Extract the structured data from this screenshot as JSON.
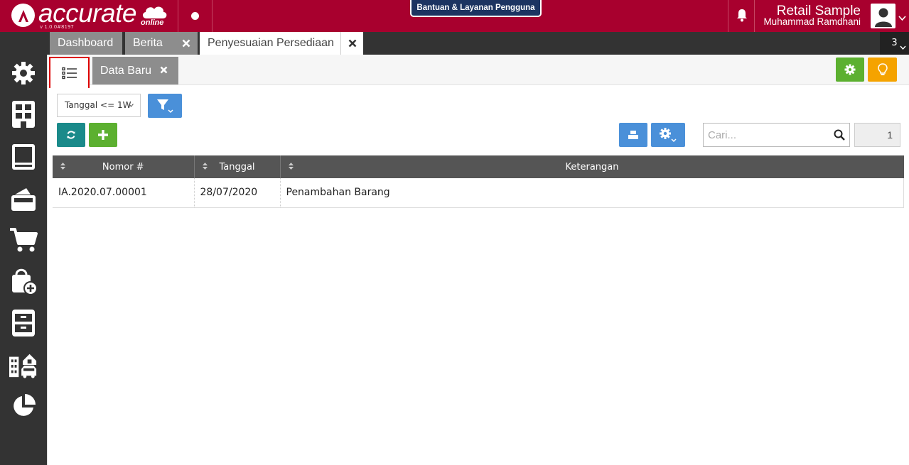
{
  "header": {
    "logo_text": "accurate",
    "logo_sub": "online",
    "version": "v 1.0.0#8197",
    "help_label": "Bantuan & Layanan Pengguna",
    "company": "Retail Sample",
    "user": "Muhammad Ramdhani",
    "brand_color": "#a8002e"
  },
  "tabs": [
    {
      "label": "Dashboard",
      "closable": false
    },
    {
      "label": "Berita",
      "closable": true
    },
    {
      "label": "Penyesuaian Persediaan",
      "closable": true,
      "active": true
    }
  ],
  "tab_count": "3",
  "sidebar": {
    "items": [
      {
        "icon": "settings-gear-icon"
      },
      {
        "icon": "company-building-icon"
      },
      {
        "icon": "ledger-book-icon"
      },
      {
        "icon": "cash-wallet-icon"
      },
      {
        "icon": "shopping-cart-icon"
      },
      {
        "icon": "purchase-bag-icon"
      },
      {
        "icon": "inventory-cabinet-icon"
      },
      {
        "icon": "assets-building-car-icon"
      },
      {
        "icon": "reports-pie-chart-icon"
      }
    ]
  },
  "subtabs": {
    "new_label": "Data Baru"
  },
  "toolbar": {
    "date_filter": "Tanggal <= 1W",
    "search_placeholder": "Cari...",
    "page_number": "1"
  },
  "table": {
    "columns": [
      "Nomor #",
      "Tanggal",
      "Keterangan"
    ],
    "rows": [
      {
        "nomor": "IA.2020.07.00001",
        "tanggal": "28/07/2020",
        "keterangan": "Penambahan Barang"
      }
    ]
  }
}
